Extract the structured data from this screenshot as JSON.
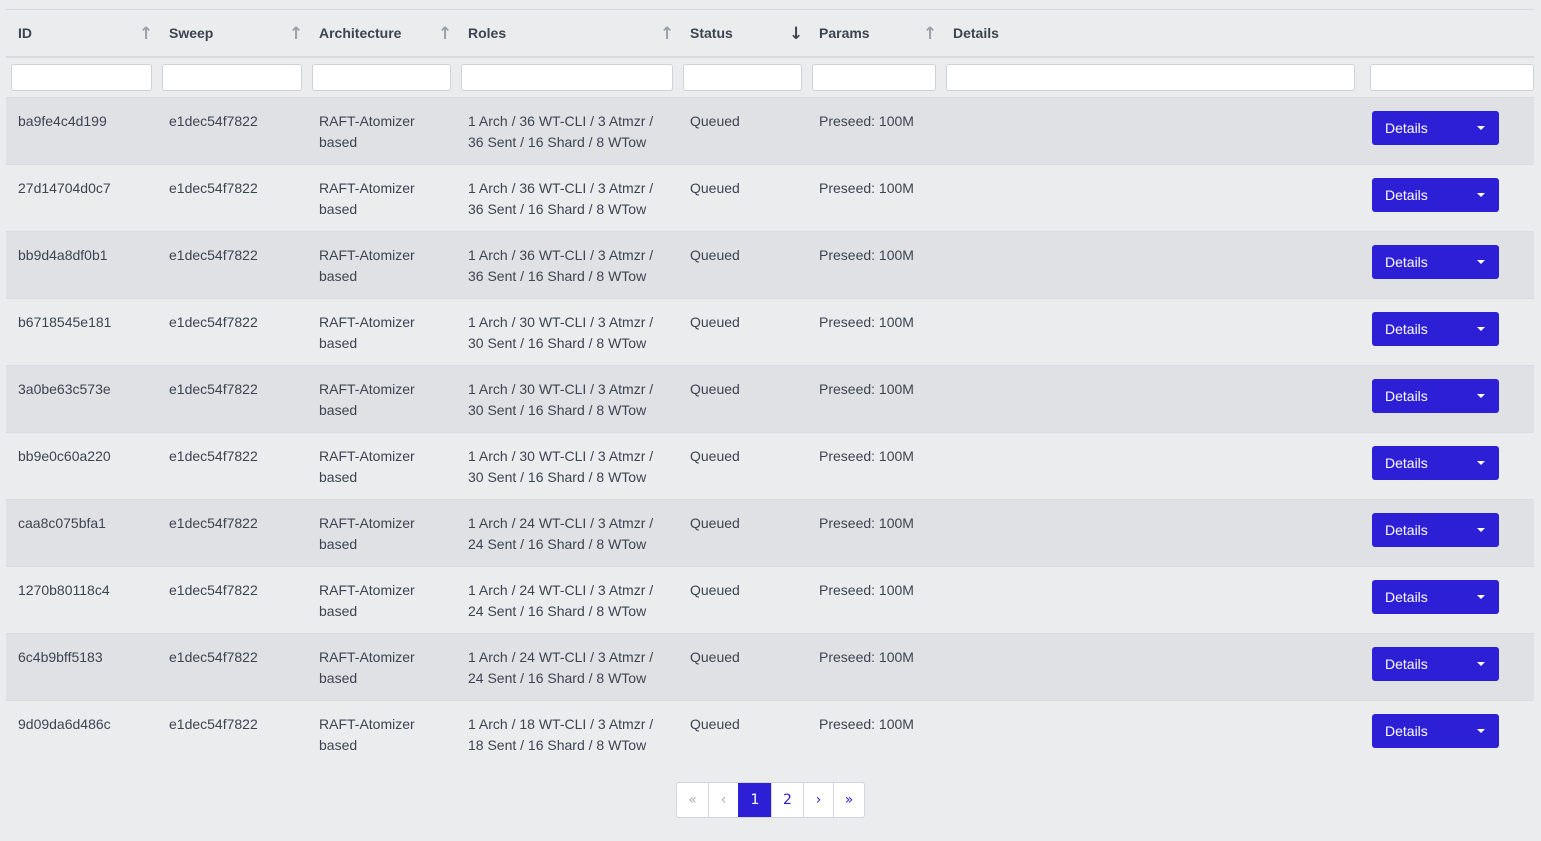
{
  "table": {
    "columns": [
      {
        "label": "ID",
        "sort": "asc"
      },
      {
        "label": "Sweep",
        "sort": "asc"
      },
      {
        "label": "Architecture",
        "sort": "asc"
      },
      {
        "label": "Roles",
        "sort": "asc"
      },
      {
        "label": "Status",
        "sort": "desc"
      },
      {
        "label": "Params",
        "sort": "asc"
      },
      {
        "label": "Details",
        "sort": ""
      }
    ],
    "rows": [
      {
        "id": "ba9fe4c4d199",
        "sweep": "e1dec54f7822",
        "arch_line1": "RAFT-Atomizer",
        "arch_line2": "based",
        "roles_line1": "1 Arch / 36 WT-CLI / 3 Atmzr /",
        "roles_line2": "36 Sent / 16 Shard / 8 WTow",
        "status": "Queued",
        "params": "Preseed: 100M"
      },
      {
        "id": "27d14704d0c7",
        "sweep": "e1dec54f7822",
        "arch_line1": "RAFT-Atomizer",
        "arch_line2": "based",
        "roles_line1": "1 Arch / 36 WT-CLI / 3 Atmzr /",
        "roles_line2": "36 Sent / 16 Shard / 8 WTow",
        "status": "Queued",
        "params": "Preseed: 100M"
      },
      {
        "id": "bb9d4a8df0b1",
        "sweep": "e1dec54f7822",
        "arch_line1": "RAFT-Atomizer",
        "arch_line2": "based",
        "roles_line1": "1 Arch / 36 WT-CLI / 3 Atmzr /",
        "roles_line2": "36 Sent / 16 Shard / 8 WTow",
        "status": "Queued",
        "params": "Preseed: 100M"
      },
      {
        "id": "b6718545e181",
        "sweep": "e1dec54f7822",
        "arch_line1": "RAFT-Atomizer",
        "arch_line2": "based",
        "roles_line1": "1 Arch / 30 WT-CLI / 3 Atmzr /",
        "roles_line2": "30 Sent / 16 Shard / 8 WTow",
        "status": "Queued",
        "params": "Preseed: 100M"
      },
      {
        "id": "3a0be63c573e",
        "sweep": "e1dec54f7822",
        "arch_line1": "RAFT-Atomizer",
        "arch_line2": "based",
        "roles_line1": "1 Arch / 30 WT-CLI / 3 Atmzr /",
        "roles_line2": "30 Sent / 16 Shard / 8 WTow",
        "status": "Queued",
        "params": "Preseed: 100M"
      },
      {
        "id": "bb9e0c60a220",
        "sweep": "e1dec54f7822",
        "arch_line1": "RAFT-Atomizer",
        "arch_line2": "based",
        "roles_line1": "1 Arch / 30 WT-CLI / 3 Atmzr /",
        "roles_line2": "30 Sent / 16 Shard / 8 WTow",
        "status": "Queued",
        "params": "Preseed: 100M"
      },
      {
        "id": "caa8c075bfa1",
        "sweep": "e1dec54f7822",
        "arch_line1": "RAFT-Atomizer",
        "arch_line2": "based",
        "roles_line1": "1 Arch / 24 WT-CLI / 3 Atmzr /",
        "roles_line2": "24 Sent / 16 Shard / 8 WTow",
        "status": "Queued",
        "params": "Preseed: 100M"
      },
      {
        "id": "1270b80118c4",
        "sweep": "e1dec54f7822",
        "arch_line1": "RAFT-Atomizer",
        "arch_line2": "based",
        "roles_line1": "1 Arch / 24 WT-CLI / 3 Atmzr /",
        "roles_line2": "24 Sent / 16 Shard / 8 WTow",
        "status": "Queued",
        "params": "Preseed: 100M"
      },
      {
        "id": "6c4b9bff5183",
        "sweep": "e1dec54f7822",
        "arch_line1": "RAFT-Atomizer",
        "arch_line2": "based",
        "roles_line1": "1 Arch / 24 WT-CLI / 3 Atmzr /",
        "roles_line2": "24 Sent / 16 Shard / 8 WTow",
        "status": "Queued",
        "params": "Preseed: 100M"
      },
      {
        "id": "9d09da6d486c",
        "sweep": "e1dec54f7822",
        "arch_line1": "RAFT-Atomizer",
        "arch_line2": "based",
        "roles_line1": "1 Arch / 18 WT-CLI / 3 Atmzr /",
        "roles_line2": "18 Sent / 16 Shard / 8 WTow",
        "status": "Queued",
        "params": "Preseed: 100M"
      }
    ],
    "action_label": "Details",
    "icons": {
      "sort_asc": "arrow-up-icon",
      "sort_desc": "arrow-down-icon",
      "dropdown": "caret-down-icon"
    }
  },
  "pagination": {
    "first": "«",
    "prev": "‹",
    "pages": [
      "1",
      "2"
    ],
    "current": "1",
    "next": "›",
    "last": "»"
  },
  "colors": {
    "accent": "#2d1fd6",
    "background": "#ebecee",
    "row_alt": "#e0e1e4",
    "text": "#3d4451"
  }
}
